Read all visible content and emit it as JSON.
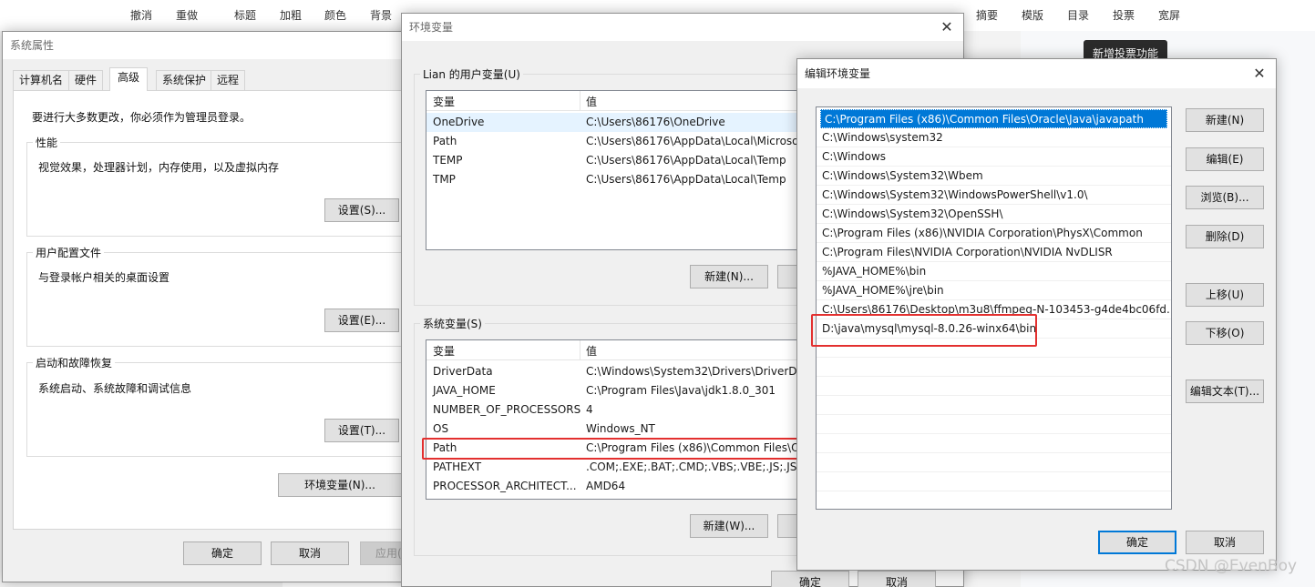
{
  "editor_toolbar": {
    "items": [
      "撤消",
      "重做",
      "标题",
      "加粗",
      "颜色",
      "背景",
      "摘要",
      "模版",
      "目录",
      "投票",
      "宽屏"
    ],
    "tooltip": "新增投票功能"
  },
  "watermark": "CSDN @EvenBoy",
  "sysprops": {
    "title": "系统属性",
    "tabs": [
      "计算机名",
      "硬件",
      "高级",
      "系统保护",
      "远程"
    ],
    "admin_note": "要进行大多数更改，你必须作为管理员登录。",
    "performance": {
      "label": "性能",
      "desc": "视觉效果，处理器计划，内存使用，以及虚拟内存",
      "button": "设置(S)..."
    },
    "profiles": {
      "label": "用户配置文件",
      "desc": "与登录帐户相关的桌面设置",
      "button": "设置(E)..."
    },
    "startup": {
      "label": "启动和故障恢复",
      "desc": "系统启动、系统故障和调试信息",
      "button": "设置(T)..."
    },
    "env_button": "环境变量(N)...",
    "ok": "确定",
    "cancel": "取消",
    "apply": "应用(A)"
  },
  "envvars": {
    "title": "环境变量",
    "user_group_label": "Lian 的用户变量(U)",
    "col_var": "变量",
    "col_val": "值",
    "user_vars": [
      {
        "name": "OneDrive",
        "value": "C:\\Users\\86176\\OneDrive"
      },
      {
        "name": "Path",
        "value": "C:\\Users\\86176\\AppData\\Local\\Microso"
      },
      {
        "name": "TEMP",
        "value": "C:\\Users\\86176\\AppData\\Local\\Temp"
      },
      {
        "name": "TMP",
        "value": "C:\\Users\\86176\\AppData\\Local\\Temp"
      }
    ],
    "user_new_button": "新建(N)...",
    "sys_group_label": "系统变量(S)",
    "sys_vars": [
      {
        "name": "DriverData",
        "value": "C:\\Windows\\System32\\Drivers\\DriverDat"
      },
      {
        "name": "JAVA_HOME",
        "value": "C:\\Program Files\\Java\\jdk1.8.0_301"
      },
      {
        "name": "NUMBER_OF_PROCESSORS",
        "value": "4"
      },
      {
        "name": "OS",
        "value": "Windows_NT"
      },
      {
        "name": "Path",
        "value": "C:\\Program Files (x86)\\Common Files\\Or"
      },
      {
        "name": "PATHEXT",
        "value": ".COM;.EXE;.BAT;.CMD;.VBS;.VBE;.JS;.JSE;."
      },
      {
        "name": "PROCESSOR_ARCHITECT...",
        "value": "AMD64"
      }
    ],
    "sys_new_button": "新建(W)...",
    "ok": "确定",
    "cancel": "取消"
  },
  "edit_env": {
    "title": "编辑环境变量",
    "entries": [
      "C:\\Program Files (x86)\\Common Files\\Oracle\\Java\\javapath",
      "C:\\Windows\\system32",
      "C:\\Windows",
      "C:\\Windows\\System32\\Wbem",
      "C:\\Windows\\System32\\WindowsPowerShell\\v1.0\\",
      "C:\\Windows\\System32\\OpenSSH\\",
      "C:\\Program Files (x86)\\NVIDIA Corporation\\PhysX\\Common",
      "C:\\Program Files\\NVIDIA Corporation\\NVIDIA NvDLISR",
      "%JAVA_HOME%\\bin",
      "%JAVA_HOME%\\jre\\bin",
      "C:\\Users\\86176\\Desktop\\m3u8\\ffmpeg-N-103453-g4de4bc06fd...",
      "D:\\java\\mysql\\mysql-8.0.26-winx64\\bin"
    ],
    "buttons": {
      "new": "新建(N)",
      "edit": "编辑(E)",
      "browse": "浏览(B)...",
      "delete": "删除(D)",
      "up": "上移(U)",
      "down": "下移(O)",
      "edit_text": "编辑文本(T)...",
      "ok": "确定",
      "cancel": "取消"
    }
  }
}
